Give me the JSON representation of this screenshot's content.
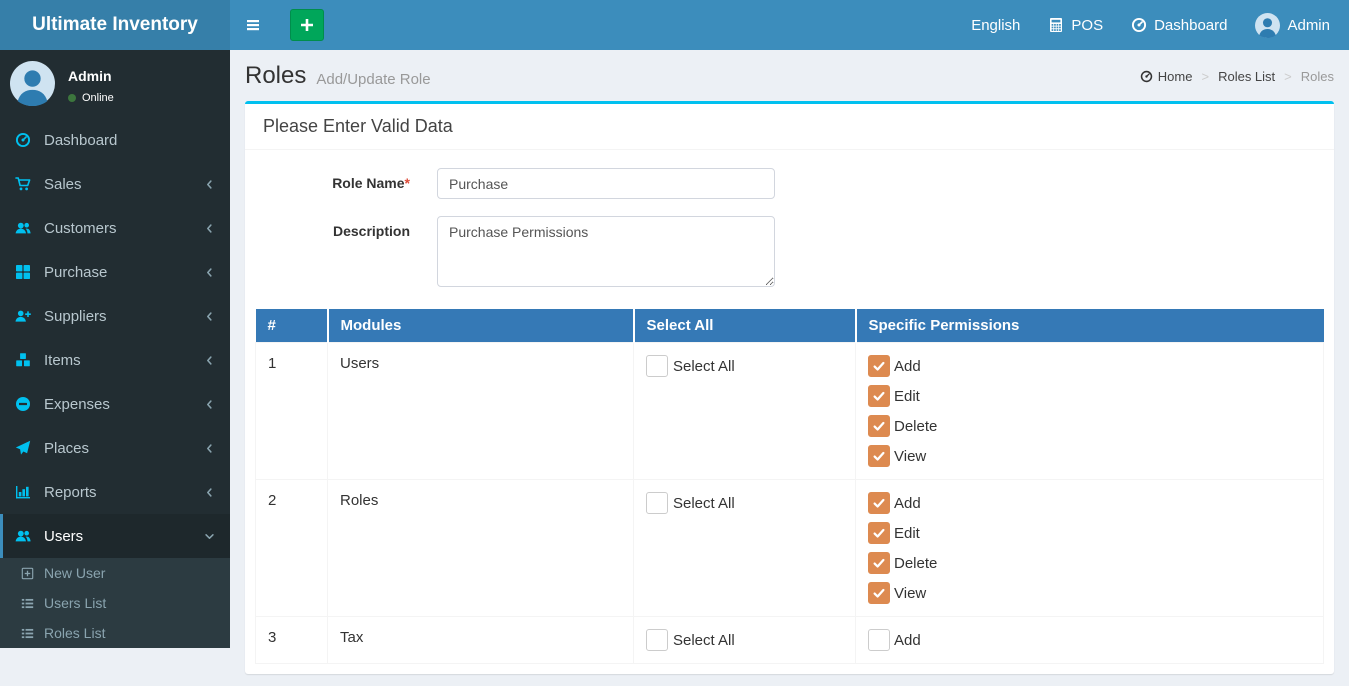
{
  "navbar": {
    "brand": "Ultimate Inventory",
    "right_items": [
      {
        "id": "language",
        "label": "English",
        "icon": null
      },
      {
        "id": "pos",
        "label": "POS",
        "icon": "calculator"
      },
      {
        "id": "dashboard",
        "label": "Dashboard",
        "icon": "gauge"
      },
      {
        "id": "account",
        "label": "Admin",
        "icon": "avatar"
      }
    ]
  },
  "sidebar": {
    "user": {
      "name": "Admin",
      "status": "Online"
    },
    "menu": [
      {
        "label": "Dashboard",
        "icon": "gauge",
        "has_submenu": false,
        "active": false
      },
      {
        "label": "Sales",
        "icon": "cart",
        "has_submenu": true,
        "active": false
      },
      {
        "label": "Customers",
        "icon": "users",
        "has_submenu": true,
        "active": false
      },
      {
        "label": "Purchase",
        "icon": "grid",
        "has_submenu": true,
        "active": false
      },
      {
        "label": "Suppliers",
        "icon": "user-plus",
        "has_submenu": true,
        "active": false
      },
      {
        "label": "Items",
        "icon": "cubes",
        "has_submenu": true,
        "active": false
      },
      {
        "label": "Expenses",
        "icon": "minus-circle",
        "has_submenu": true,
        "active": false
      },
      {
        "label": "Places",
        "icon": "paper-plane",
        "has_submenu": true,
        "active": false
      },
      {
        "label": "Reports",
        "icon": "bar-chart",
        "has_submenu": true,
        "active": false
      },
      {
        "label": "Users",
        "icon": "users",
        "has_submenu": true,
        "active": true,
        "expanded": true,
        "submenu": [
          {
            "label": "New User",
            "icon": "plus-square"
          },
          {
            "label": "Users List",
            "icon": "list"
          },
          {
            "label": "Roles List",
            "icon": "list"
          }
        ]
      }
    ]
  },
  "content": {
    "page_title": "Roles",
    "page_subtitle": "Add/Update Role",
    "breadcrumb": {
      "items": [
        {
          "label": "Home",
          "icon": "gauge",
          "active": false
        },
        {
          "label": "Roles List",
          "icon": null,
          "active": false
        },
        {
          "label": "Roles",
          "icon": null,
          "active": true
        }
      ]
    },
    "box": {
      "title": "Please Enter Valid Data",
      "form": {
        "role_name_label": "Role Name",
        "required_marker": "*",
        "role_name_value": "Purchase",
        "description_label": "Description",
        "description_value": "Purchase Permissions"
      },
      "table": {
        "headers": [
          "#",
          "Modules",
          "Select All",
          "Specific Permissions"
        ],
        "select_all_label": "Select All",
        "rows": [
          {
            "num": "1",
            "module": "Users",
            "select_all_checked": false,
            "permissions": [
              {
                "label": "Add",
                "checked": true
              },
              {
                "label": "Edit",
                "checked": true
              },
              {
                "label": "Delete",
                "checked": true
              },
              {
                "label": "View",
                "checked": true
              }
            ]
          },
          {
            "num": "2",
            "module": "Roles",
            "select_all_checked": false,
            "permissions": [
              {
                "label": "Add",
                "checked": true
              },
              {
                "label": "Edit",
                "checked": true
              },
              {
                "label": "Delete",
                "checked": true
              },
              {
                "label": "View",
                "checked": true
              }
            ]
          },
          {
            "num": "3",
            "module": "Tax",
            "select_all_checked": false,
            "permissions": [
              {
                "label": "Add",
                "checked": false
              }
            ]
          }
        ]
      }
    }
  },
  "colors": {
    "navbar": "#3c8dbc",
    "logo_bg": "#367fa9",
    "sidebar_bg": "#222d32",
    "sidebar_icon": "#00c0ef",
    "box_accent": "#00c0ef",
    "table_header": "#3579b6",
    "checkbox_checked": "#dd8a50",
    "add_button": "#00a65a",
    "online_dot": "#3c763d"
  }
}
